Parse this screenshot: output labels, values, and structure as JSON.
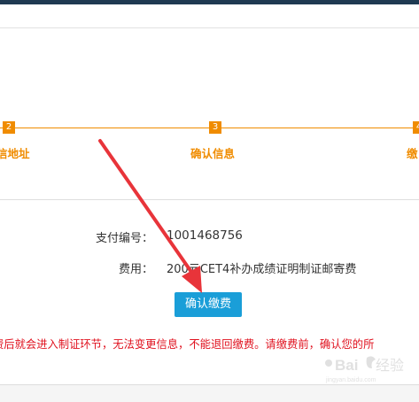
{
  "steps": [
    {
      "number": "2",
      "label": "信地址"
    },
    {
      "number": "3",
      "label": "确认信息"
    },
    {
      "number": "4",
      "label": "缴"
    }
  ],
  "payment": {
    "id_label": "支付编号：",
    "id_value": "1001468756",
    "fee_label": "费用：",
    "fee_value": "200元CET4补办成绩证明制证邮寄费"
  },
  "confirm_button": "确认缴费",
  "warning_text": "费后就会进入制证环节，无法变更信息，不能退回缴费。请缴费前，确认您的所",
  "colors": {
    "accent_orange": "#f08c00",
    "button_blue": "#1a9ed8",
    "warning_red": "#e0121f",
    "annotation_arrow": "#e8343a"
  },
  "watermark": "Bai经验"
}
